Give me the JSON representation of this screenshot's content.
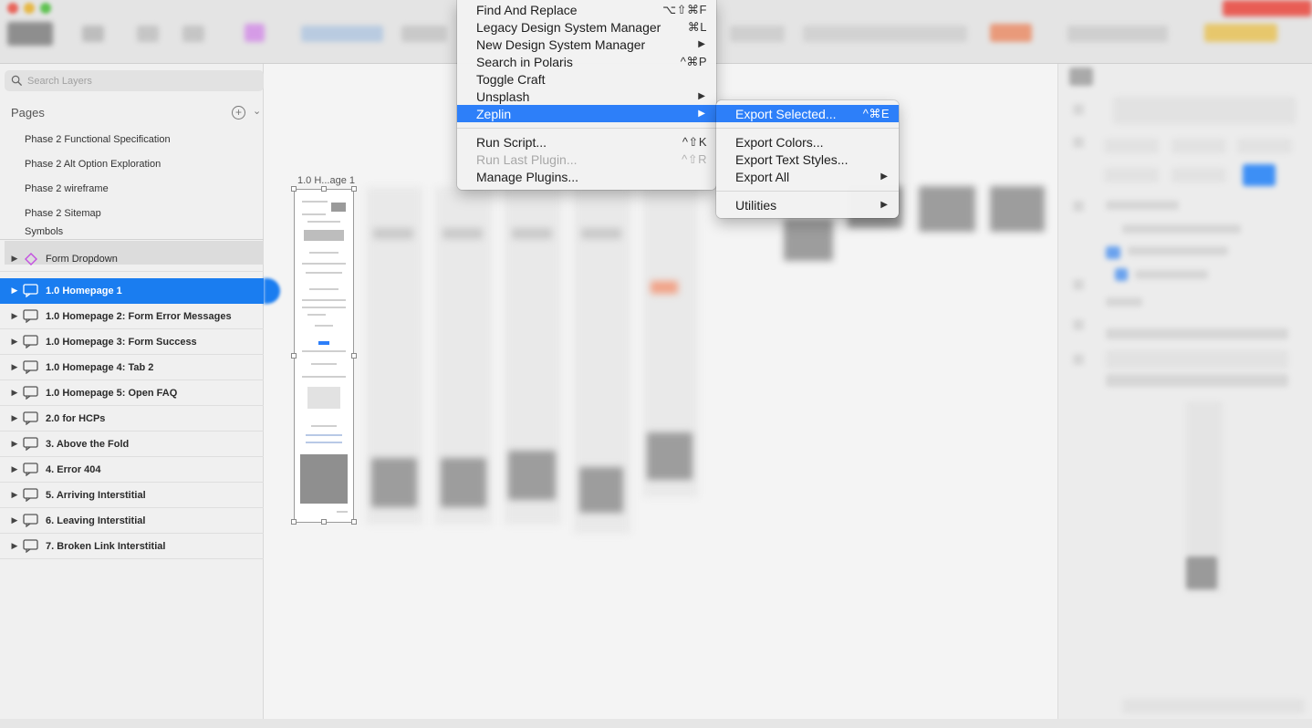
{
  "search": {
    "placeholder": "Search Layers"
  },
  "pages": {
    "title": "Pages",
    "items": [
      {
        "label": "Phase 2 Functional Specification"
      },
      {
        "label": "Phase 2 Alt Option Exploration"
      },
      {
        "label": "Phase 2 wireframe"
      },
      {
        "label": "Phase 2 Sitemap"
      },
      {
        "label": "Symbols"
      }
    ]
  },
  "layers": {
    "symbol_row": {
      "label": "Form Dropdown"
    },
    "artboards": [
      {
        "label": "1.0 Homepage 1"
      },
      {
        "label": "1.0 Homepage 2: Form Error Messages"
      },
      {
        "label": "1.0 Homepage 3: Form Success"
      },
      {
        "label": "1.0 Homepage 4: Tab 2"
      },
      {
        "label": "1.0 Homepage 5: Open FAQ"
      },
      {
        "label": "2.0 for HCPs"
      },
      {
        "label": "3. Above the Fold"
      },
      {
        "label": "4. Error 404"
      },
      {
        "label": "5. Arriving Interstitial"
      },
      {
        "label": "6. Leaving Interstitial"
      },
      {
        "label": "7. Broken Link Interstitial"
      }
    ]
  },
  "canvas": {
    "artboard_label": "1.0 H...age 1"
  },
  "plugins_menu": {
    "items": [
      {
        "label": "Find And Replace",
        "shortcut": "⌥⇧⌘F"
      },
      {
        "label": "Legacy Design System Manager",
        "shortcut": "⌘L"
      },
      {
        "label": "New Design System Manager",
        "arrow": "▶"
      },
      {
        "label": "Search in Polaris",
        "shortcut": "^⌘P"
      },
      {
        "label": "Toggle Craft"
      },
      {
        "label": "Unsplash",
        "arrow": "▶"
      },
      {
        "label": "Zeplin",
        "arrow": "▶"
      },
      {
        "label": "Run Script...",
        "shortcut": "^⇧K"
      },
      {
        "label": "Run Last Plugin...",
        "shortcut": "^⇧R"
      },
      {
        "label": "Manage Plugins..."
      }
    ]
  },
  "zeplin_menu": {
    "items": [
      {
        "label": "Export Selected...",
        "shortcut": "^⌘E"
      },
      {
        "label": "Export Colors..."
      },
      {
        "label": "Export Text Styles..."
      },
      {
        "label": "Export All",
        "arrow": "▶"
      },
      {
        "label": "Utilities",
        "arrow": "▶"
      }
    ]
  },
  "colors": {
    "selection": "#1a7df0",
    "menu_highlight": "#2d7ff9",
    "symbol_icon": "#c34fe0"
  }
}
